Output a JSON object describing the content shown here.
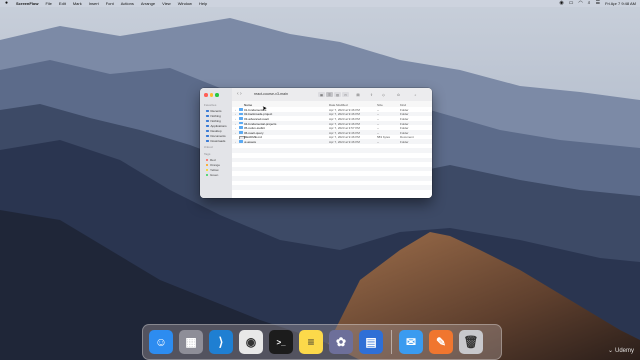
{
  "menubar": {
    "app_name": "ScreenFlow",
    "menus": [
      "File",
      "Edit",
      "Mark",
      "Insert",
      "Font",
      "Actions",
      "Arrange",
      "View",
      "Window",
      "Help"
    ],
    "clock": "Fri Apr 7  9:48 AM"
  },
  "finder": {
    "title": "react-course-v3-main",
    "sidebar": {
      "favorites_label": "Favorites",
      "favorites": [
        "Recents",
        "Nothing",
        "Nothing",
        "Applications",
        "Desktop",
        "Documents",
        "Downloads"
      ],
      "icloud_label": "iCloud",
      "tags_label": "Tags",
      "tags": [
        {
          "label": "Red",
          "color": "#ff5f57"
        },
        {
          "label": "Orange",
          "color": "#ff9f0a"
        },
        {
          "label": "Yellow",
          "color": "#ffd60a"
        },
        {
          "label": "Green",
          "color": "#30d158"
        }
      ]
    },
    "columns": {
      "name": "Name",
      "date": "Date Modified",
      "size": "Size",
      "kind": "Kind"
    },
    "rows": [
      {
        "name": "01-fundamentals",
        "date": "Apr 7, 2023 at 9:46 PM",
        "size": "--",
        "kind": "Folder",
        "folder": true
      },
      {
        "name": "02-backroads-project",
        "date": "Apr 7, 2023 at 9:46 PM",
        "size": "--",
        "kind": "Folder",
        "folder": true
      },
      {
        "name": "03-advanced-react",
        "date": "Apr 7, 2023 at 9:46 PM",
        "size": "--",
        "kind": "Folder",
        "folder": true
      },
      {
        "name": "04-fundamental-projects",
        "date": "Apr 7, 2023 at 9:46 PM",
        "size": "--",
        "kind": "Folder",
        "folder": true
      },
      {
        "name": "05-redux-toolkit",
        "date": "Apr 7, 2023 at 3:57 PM",
        "size": "--",
        "kind": "Folder",
        "folder": true
      },
      {
        "name": "06-react-query",
        "date": "Apr 7, 2023 at 9:46 PM",
        "size": "--",
        "kind": "Folder",
        "folder": true
      },
      {
        "name": "README.md",
        "date": "Apr 7, 2023 at 9:46 PM",
        "size": "583 bytes",
        "kind": "Document",
        "folder": false
      },
      {
        "name": "ui-assets",
        "date": "Apr 7, 2023 at 9:46 PM",
        "size": "--",
        "kind": "Folder",
        "folder": true
      }
    ]
  },
  "dock": {
    "apps": [
      {
        "name": "finder",
        "glyph": "☺",
        "color": "#2d8cf0"
      },
      {
        "name": "launchpad",
        "glyph": "▦",
        "color": "#8e8e98"
      },
      {
        "name": "vscode",
        "glyph": "⟩",
        "color": "#1f7fd2"
      },
      {
        "name": "chrome",
        "glyph": "◉",
        "color": "#e8e8e8"
      },
      {
        "name": "terminal",
        "glyph": ">_",
        "color": "#1c1c1c"
      },
      {
        "name": "notes",
        "glyph": "≡",
        "color": "#fcd94a"
      },
      {
        "name": "screenflow",
        "glyph": "✿",
        "color": "#6d6f9a"
      },
      {
        "name": "dash",
        "glyph": "▤",
        "color": "#2f6fd6"
      },
      {
        "name": "mail",
        "glyph": "✉",
        "color": "#3a9bf0"
      },
      {
        "name": "pages",
        "glyph": "✎",
        "color": "#f0762f"
      },
      {
        "name": "trash",
        "glyph": "🗑",
        "color": "#c8c8cc"
      }
    ]
  },
  "watermark": "Udemy"
}
